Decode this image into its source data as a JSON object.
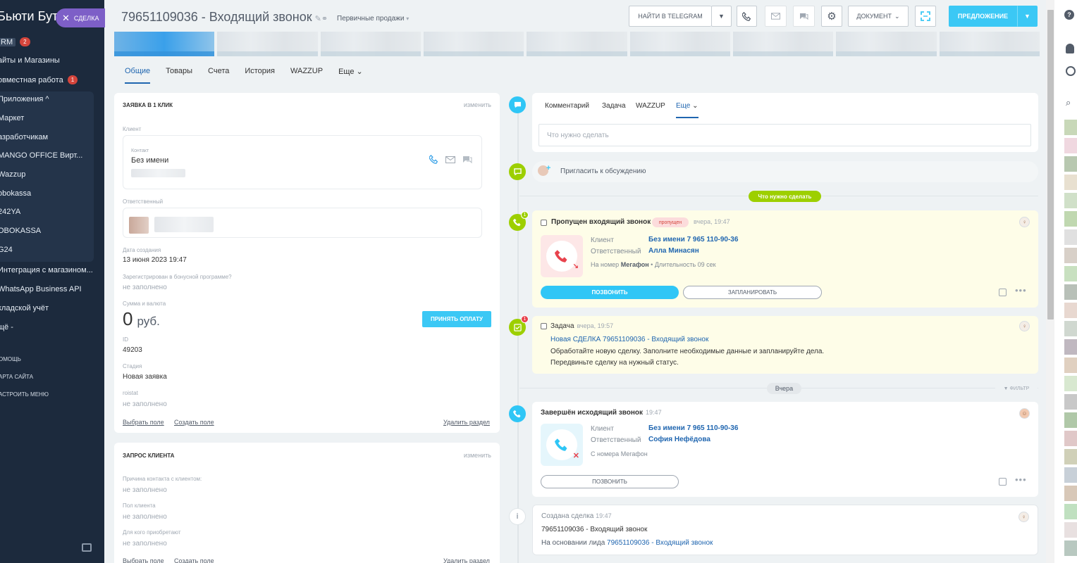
{
  "sidebar": {
    "title": "Бьюти Бут",
    "close_label": "СДЕЛКА",
    "items": [
      {
        "label": "RM",
        "badge": "2"
      },
      {
        "label": "айты и Магазины",
        "badge": ""
      },
      {
        "label": "овместная работа",
        "badge": "1"
      },
      {
        "label": "Приложения ^",
        "badge": ""
      },
      {
        "label": "Маркет",
        "badge": ""
      },
      {
        "label": "азработчикам",
        "badge": ""
      },
      {
        "label": "MANGO OFFICE Вирт...",
        "badge": ""
      },
      {
        "label": "Wazzup",
        "badge": ""
      },
      {
        "label": "obokassa",
        "badge": ""
      },
      {
        "label": "242YA",
        "badge": ""
      },
      {
        "label": "OBOKASSA",
        "badge": ""
      },
      {
        "label": "G24",
        "badge": ""
      },
      {
        "label": "Интеграция с магазином...",
        "badge": ""
      },
      {
        "label": "WhatsApp Business API",
        "badge": ""
      },
      {
        "label": "кладской учёт",
        "badge": ""
      },
      {
        "label": "щё -",
        "badge": ""
      }
    ],
    "footer": [
      "омощь",
      "арта сайта",
      "астроить меню"
    ]
  },
  "header": {
    "title": "79651109036 - Входящий звонок",
    "subtitle": "Первичные продажи",
    "buttons": {
      "telegram": "НАЙТИ В TELEGRAM",
      "document": "ДОКУМЕНТ",
      "offer": "ПРЕДЛОЖЕНИЕ"
    }
  },
  "tabs": [
    "Общие",
    "Товары",
    "Счета",
    "История",
    "WAZZUP",
    "Еще"
  ],
  "left": {
    "section1": {
      "title": "ЗАЯВКА В 1 КЛИК",
      "edit": "изменить",
      "client_label": "Клиент",
      "contact_label": "Контакт",
      "contact_name": "Без имени",
      "responsible_label": "Ответственный",
      "created_label": "Дата создания",
      "created_value": "13 июня 2023 19:47",
      "bonus_label": "Зарегистрирован в бонусной программе?",
      "bonus_value": "не заполнено",
      "sum_label": "Сумма и валюта",
      "sum_amount": "0",
      "sum_currency": "руб.",
      "pay_button": "ПРИНЯТЬ ОПЛАТУ",
      "id_label": "ID",
      "id_value": "49203",
      "stage_label": "Стадия",
      "stage_value": "Новая заявка",
      "roistat_label": "roistat",
      "roistat_value": "не заполнено",
      "select_field": "Выбрать поле",
      "create_field": "Создать поле",
      "delete_section": "Удалить раздел"
    },
    "section2": {
      "title": "ЗАПРОС КЛИЕНТА",
      "edit": "изменить",
      "reason_label": "Причина контакта с клиентом:",
      "reason_value": "не заполнено",
      "gender_label": "Пол клиента",
      "gender_value": "не заполнено",
      "for_whom_label": "Для кого приобретают",
      "for_whom_value": "не заполнено",
      "select_field": "Выбрать поле",
      "create_field": "Создать поле",
      "delete_section": "Удалить раздел"
    }
  },
  "timeline": {
    "composer_tabs": [
      "Комментарий",
      "Задача",
      "WAZZUP",
      "Еще"
    ],
    "composer_placeholder": "Что нужно сделать",
    "invite": "Пригласить к обсуждению",
    "todo_pill": "Что нужно сделать",
    "missed": {
      "title": "Пропущен входящий звонок",
      "tag": "пропущен",
      "time": "вчера, 19:47",
      "client_label": "Клиент",
      "client_value": "Без имени 7 965 110-90-36",
      "resp_label": "Ответственный",
      "resp_value": "Алла Минасян",
      "meta_prefix": "На номер",
      "meta_line": "Мегафон",
      "meta_duration": "• Длительность 09 сек",
      "call_button": "ПОЗВОНИТЬ",
      "plan_button": "ЗАПЛАНИРОВАТЬ",
      "badge": "1"
    },
    "task": {
      "title": "Задача",
      "time": "вчера, 19:57",
      "link": "Новая СДЕЛКА 79651109036 - Входящий звонок",
      "text1": "Обработайте новую сделку. Заполните необходимые данные и запланируйте дела.",
      "text2": "Передвиньте сделку на нужный статус.",
      "badge": "1"
    },
    "yesterday_pill": "Вчера",
    "filter": "ФИЛЬТР",
    "outgoing": {
      "title": "Завершён исходящий звонок",
      "time": "19:47",
      "client_label": "Клиент",
      "client_value": "Без имени 7 965 110-90-36",
      "resp_label": "Ответственный",
      "resp_value": "София Нефёдова",
      "meta_prefix": "С номера",
      "meta_line": "Мегафон",
      "call_button": "ПОЗВОНИТЬ"
    },
    "created": {
      "title": "Создана сделка",
      "time": "19:47",
      "text": "79651109036 - Входящий звонок",
      "basis_prefix": "На основании лида",
      "basis_link": "79651109036 - Входящий звонок"
    }
  },
  "colors": {
    "accent": "#3bc8f5",
    "link": "#2066b0",
    "sidebar_bg": "#1c2a3d",
    "green": "#9dcf00",
    "missed_bg": "#fefde8"
  }
}
